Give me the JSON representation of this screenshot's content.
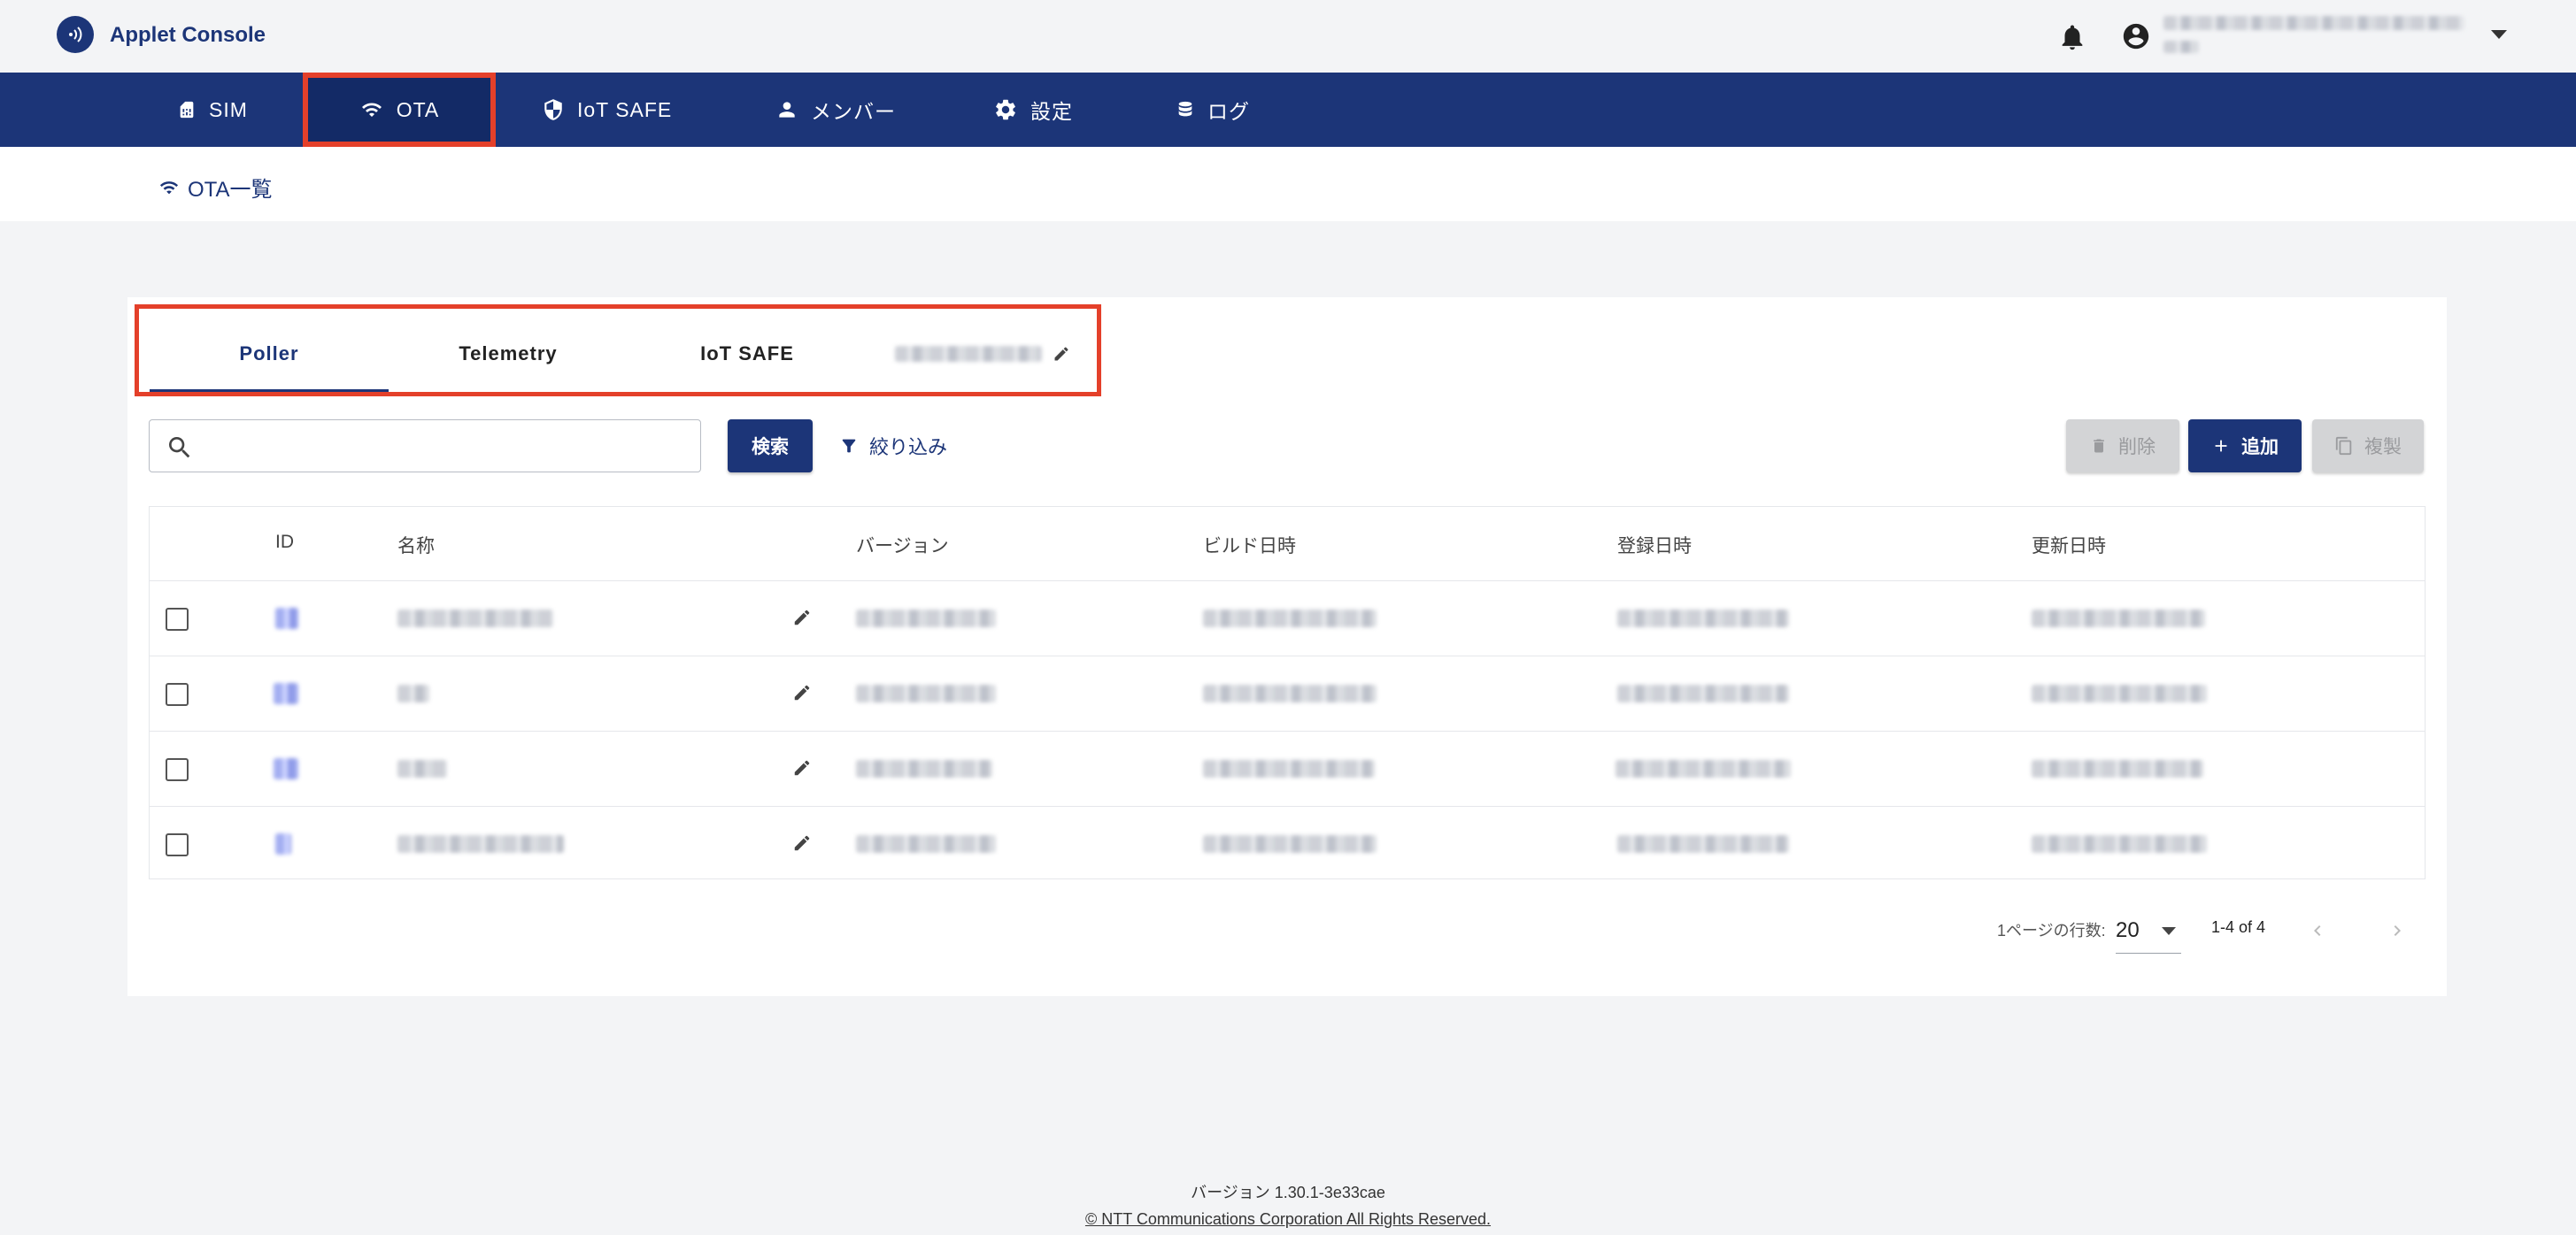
{
  "header": {
    "app_title": "Applet Console",
    "bell_icon": "bell-icon",
    "account_icon": "account-circle-icon"
  },
  "nav": {
    "items": [
      {
        "label": "SIM",
        "icon": "sim-card-icon"
      },
      {
        "label": "OTA",
        "icon": "wifi-icon",
        "active": true
      },
      {
        "label": "IoT SAFE",
        "icon": "shield-icon"
      },
      {
        "label": "メンバー",
        "icon": "person-icon"
      },
      {
        "label": "設定",
        "icon": "gear-icon"
      },
      {
        "label": "ログ",
        "icon": "database-icon"
      }
    ]
  },
  "subnav": {
    "link_label": "OTA一覧"
  },
  "tabs": [
    {
      "label": "Poller",
      "active": true
    },
    {
      "label": "Telemetry"
    },
    {
      "label": "IoT SAFE"
    }
  ],
  "toolbar": {
    "search_placeholder": "",
    "search_button": "検索",
    "filter_label": "絞り込み",
    "delete_label": "削除",
    "add_label": "追加",
    "copy_label": "複製"
  },
  "table": {
    "columns": [
      "ID",
      "名称",
      "バージョン",
      "ビルド日時",
      "登録日時",
      "更新日時"
    ],
    "row_count": 4
  },
  "pagination": {
    "rows_per_page_label": "1ページの行数:",
    "rows_per_page_value": "20",
    "range_label": "1-4 of 4"
  },
  "footer": {
    "version": "バージョン 1.30.1-3e33cae",
    "copyright": "© NTT Communications Corporation All Rights Reserved."
  },
  "colors": {
    "brand": "#1c3578",
    "highlight": "#e4402a",
    "background": "#f3f4f6"
  }
}
